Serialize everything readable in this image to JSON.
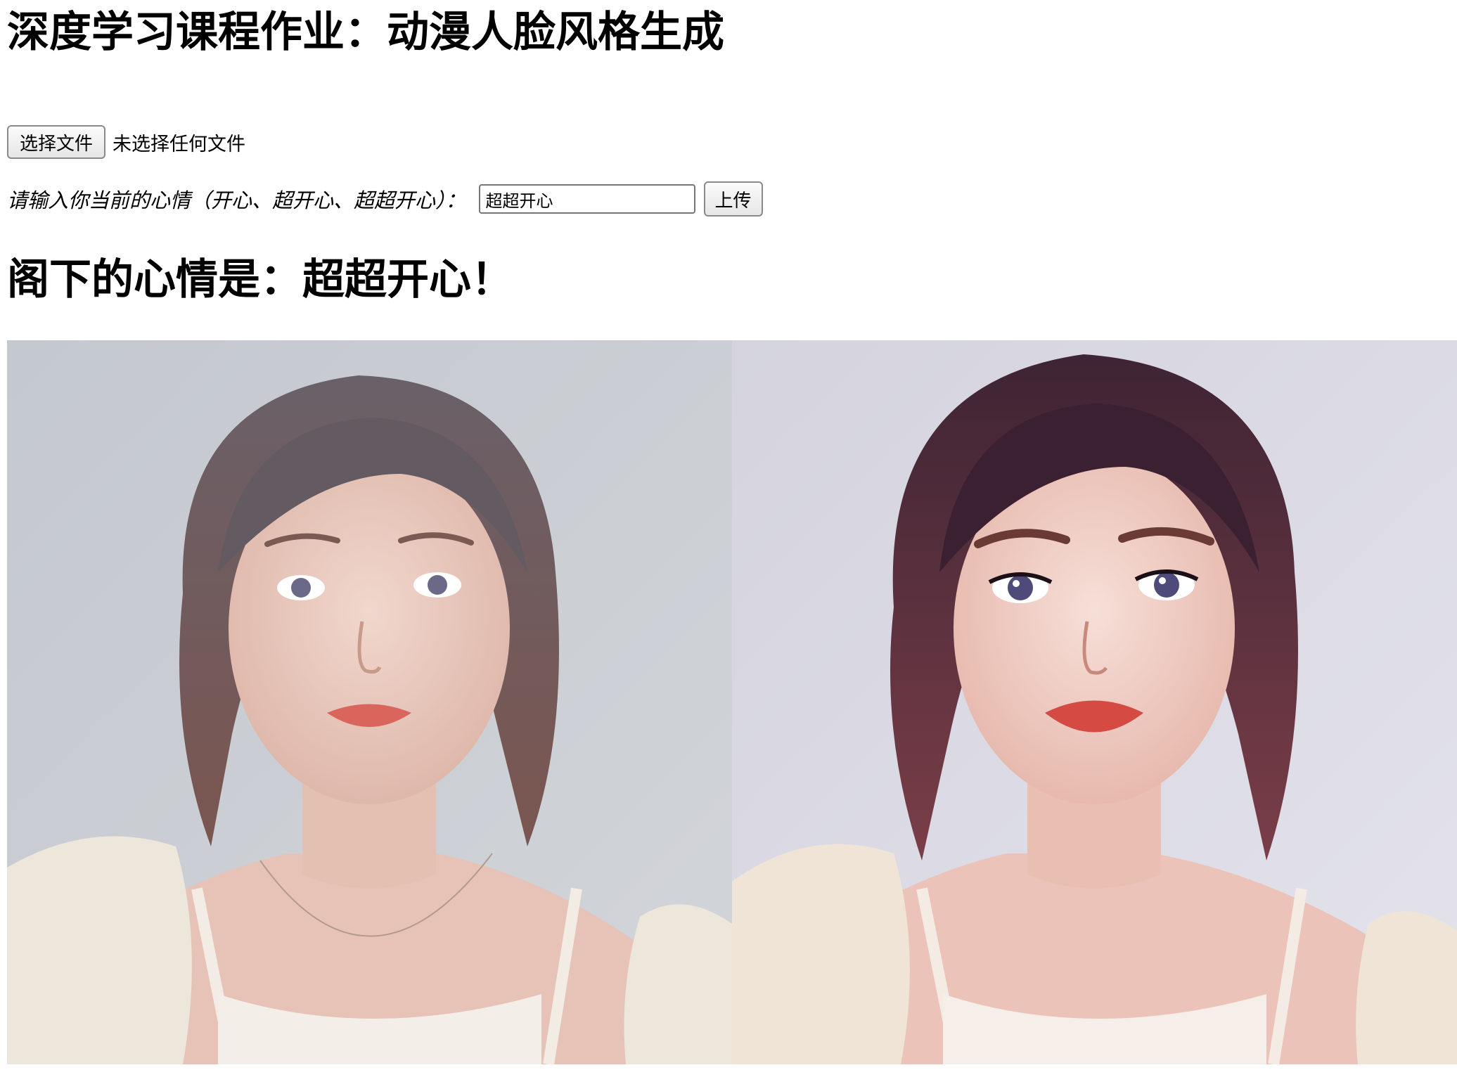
{
  "page": {
    "title": "深度学习课程作业：动漫人脸风格生成"
  },
  "file_upload": {
    "button_label": "选择文件",
    "status": "未选择任何文件"
  },
  "mood": {
    "label": "请输入你当前的心情（开心、超开心、超超开心）：",
    "value": "超超开心",
    "submit_label": "上传"
  },
  "result": {
    "text": "阁下的心情是：超超开心！"
  },
  "images": {
    "original": "original-portrait",
    "generated": "anime-style-portrait"
  },
  "colors": {
    "text": "#000000",
    "background": "#ffffff",
    "photo_bg_original": "#c9cdd3",
    "photo_bg_generated": "#dcdce6",
    "hair": "#5a4a4c",
    "hair_anime": "#4a2a38",
    "skin": "#e9cbc1",
    "lips": "#d9655c",
    "cardigan": "#efe7dc"
  }
}
